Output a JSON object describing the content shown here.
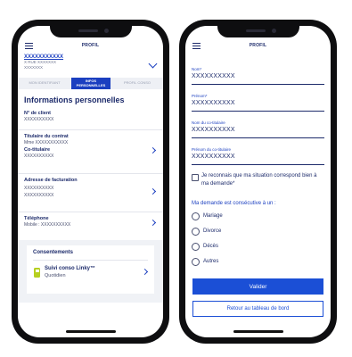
{
  "left_screen": {
    "header": {
      "title": "PROFIL"
    },
    "account": {
      "name": "XXXXXXXXXXX",
      "address_line": "X RUE XXXXXXX",
      "city_line": "XXXXXXX"
    },
    "tabs": [
      {
        "label": "MON IDENTIFIANT"
      },
      {
        "label": "INFOS PERSONNELLES"
      },
      {
        "label": "PROFIL CONSO"
      }
    ],
    "section_title": "Informations personnelles",
    "client": {
      "label": "N° de client",
      "value": "XXXXXXXXXX"
    },
    "holder": {
      "label": "Titulaire du contrat",
      "value": "Mme XXXXXXXXXXX",
      "co_label": "Co-titulaire",
      "co_value": "XXXXXXXXXX"
    },
    "billing": {
      "label": "Adresse de facturation",
      "line1": "XXXXXXXXXX",
      "line2": "XXXXXXXXXX"
    },
    "phone": {
      "label": "Téléphone",
      "value": "Mobile : XXXXXXXXXX"
    },
    "consents": {
      "title": "Consentements",
      "item_name": "Suivi conso Linky™",
      "item_sub": "Quotidien"
    }
  },
  "right_screen": {
    "header": {
      "title": "PROFIL"
    },
    "fields": [
      {
        "label": "Nom*",
        "value": "XXXXXXXXXX"
      },
      {
        "label": "Prénom*",
        "value": "XXXXXXXXXX"
      },
      {
        "label": "Nom du co-titulaire",
        "value": "XXXXXXXXXX"
      },
      {
        "label": "Prénom du co-titulaire",
        "value": "XXXXXXXXXX"
      }
    ],
    "checkbox_label": "Je reconnais que ma situation correspond bien à ma demande*",
    "question": "Ma demande est consécutive à un :",
    "options": [
      {
        "label": "Mariage"
      },
      {
        "label": "Divorce"
      },
      {
        "label": "Décès"
      },
      {
        "label": "Autres"
      }
    ],
    "submit_label": "Valider",
    "back_label": "Retour au tableau de bord"
  },
  "colors": {
    "primary": "#1b4fd6",
    "navy": "#1d2b6b",
    "linky_green": "#b6cf20"
  }
}
